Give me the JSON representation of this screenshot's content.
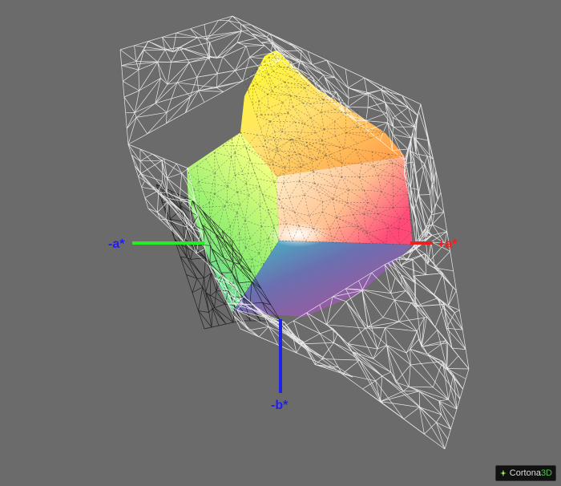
{
  "viewer": {
    "brand_name": "Cortona",
    "brand_suffix": "3D",
    "background": "#6b6b6b"
  },
  "axes": {
    "neg_a": {
      "label": "-a*",
      "color": "#2020e8",
      "line_color": "#22ee22"
    },
    "pos_a": {
      "label": "+a*",
      "color": "#ee2020",
      "line_color": "#ee2020"
    },
    "neg_b": {
      "label": "-b*",
      "color": "#2020e8",
      "line_color": "#2020ee"
    }
  },
  "gamut": {
    "solid_colors": [
      "#ffff00",
      "#ffa030",
      "#ff5070",
      "#ff80c0",
      "#a050a0",
      "#5060a0",
      "#40c0c0",
      "#80e060",
      "#ffffff"
    ],
    "wireframe_color": "#ffffff",
    "shadow_wire_color": "#1a1a1a"
  }
}
